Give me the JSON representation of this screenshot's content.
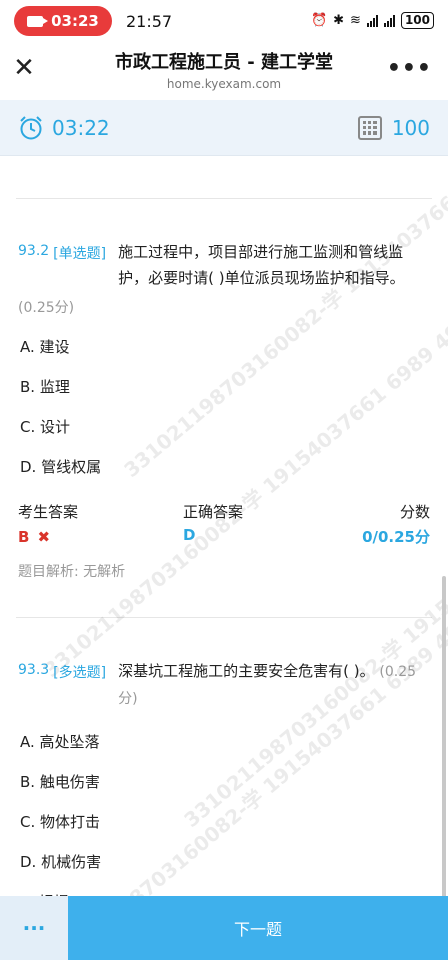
{
  "status_bar": {
    "recording_time": "03:23",
    "clock": "21:57",
    "battery": "100"
  },
  "header": {
    "title": "市政工程施工员 - 建工学堂",
    "url": "home.kyexam.com"
  },
  "toolbar": {
    "timer": "03:22",
    "question_count": "100"
  },
  "watermark": "331021198703160082-学 19154037661 6989 4912",
  "questions": [
    {
      "number": "93.2",
      "type": "[单选题]",
      "text": "施工过程中，项目部进行施工监测和管线监护，必要时请( )单位派员现场监护和指导。",
      "score": "(0.25分)",
      "options": [
        "A. 建设",
        "B. 监理",
        "C. 设计",
        "D. 管线权属"
      ],
      "answer_labels": {
        "mine": "考生答案",
        "correct": "正确答案",
        "score": "分数"
      },
      "answer_values": {
        "mine": "B",
        "correct": "D",
        "score": "0/0.25分"
      },
      "analysis": "题目解析:   无解析"
    },
    {
      "number": "93.3",
      "type": "[多选题]",
      "text": "深基坑工程施工的主要安全危害有( )。",
      "score": "(0.25分)",
      "options": [
        "A. 高处坠落",
        "B. 触电伤害",
        "C. 物体打击",
        "D. 机械伤害",
        "E. 坍塌"
      ]
    }
  ],
  "bottom_bar": {
    "more": "···",
    "next": "下一题"
  }
}
